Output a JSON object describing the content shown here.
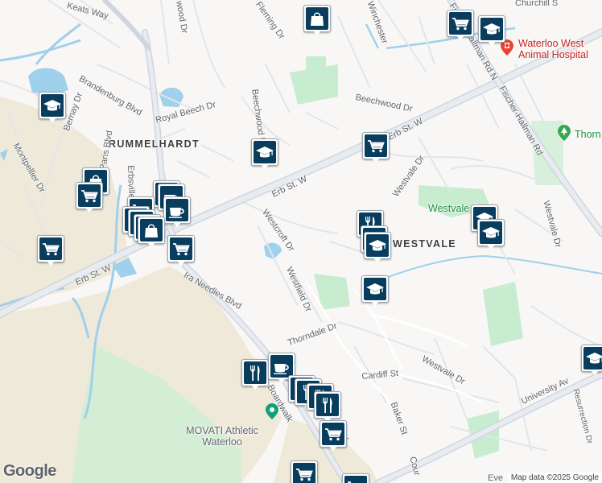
{
  "map": {
    "attribution": "Map data ©2025 Google",
    "google_logo": "Google",
    "area_labels": {
      "rummelhardt": "RUMMELHARDT",
      "westvale": "WESTVALE"
    },
    "street_labels": {
      "keats_way": "Keats Way",
      "fleming_dr": "Fleming Dr",
      "winchester": "Winchester",
      "churchill": "Churchill S",
      "wood_dr": "wood Dr",
      "fischer_hallman_n": "Fischer-Hallman Rd N",
      "brandenburg_blvd": "Brandenburg Blvd",
      "royal_beech_dr": "Royal Beech Dr",
      "beechwood_dr_a": "Beechwood Dr",
      "beechwood_dr_b": "Beechwood Dr",
      "bernay_dr": "Bernay Dr",
      "paris_blvd": "Paris Blvd",
      "montpellier_dr": "Montpellier Dr",
      "erb_st_w_a": "Erb St. W",
      "erb_st_w_b": "Erb St. W",
      "erb_st_w_c": "Erb St. W",
      "erbsville": "Erbsville",
      "fischer_hallman": "Fischer-Hallman Rd",
      "westvale_dr_a": "Westvale Dr",
      "westvale_dr_b": "Westvale Dr",
      "westvale_dr_c": "Westvale Dr",
      "westcroft_dr": "Westcroft Dr",
      "westfield_dr": "Westfield Dr",
      "ira_needles_blvd": "Ira Needles Blvd",
      "thorndale_dr": "Thorndale Dr",
      "cardiff_st": "Cardiff St",
      "university_av": "University Av",
      "resurrection_dr": "Resurrection Dr",
      "boardwalk": "Boardwalk",
      "blvd": "Blvd",
      "baker_st": "Baker St",
      "cour": "Cour"
    },
    "poi_labels": {
      "animal_hospital": "Waterloo West Animal Hospital",
      "movati": "MOVATI Athletic Waterloo",
      "westvale_park": "Westvale Pa",
      "thorn": "Thorn",
      "eve": "Eve"
    },
    "marker_icons": {
      "school": "graduation-cap-icon",
      "grocery": "shopping-cart-icon",
      "shopping": "shopping-bag-icon",
      "restaurant": "fork-knife-icon",
      "cafe": "coffee-cup-icon"
    },
    "colors": {
      "marker_fill": "#083d5d",
      "water": "#9fd0ec",
      "park": "#c7ecd0",
      "sand": "#efe9d9",
      "road": "#ffffff",
      "arterial": "#cfd6e0"
    }
  }
}
